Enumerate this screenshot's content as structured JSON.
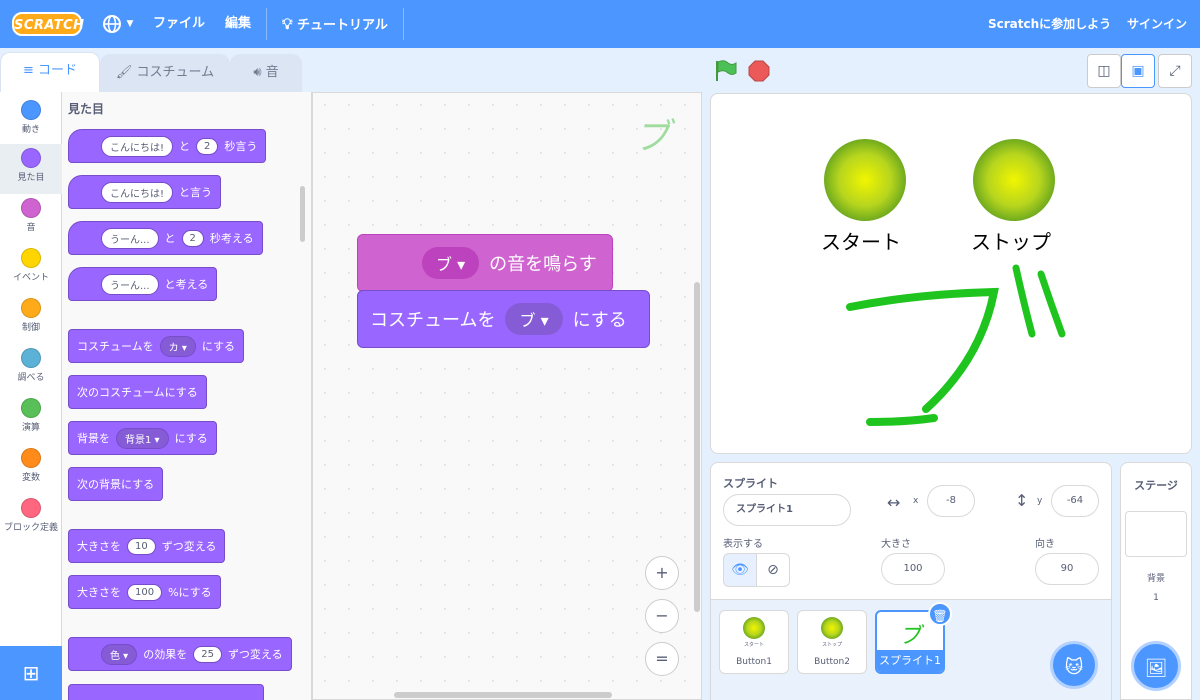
{
  "menubar": {
    "logo": "SCRATCH",
    "file": "ファイル",
    "edit": "編集",
    "tutorials": "チュートリアル",
    "join": "Scratchに参加しよう",
    "signin": "サインイン",
    "color": "#4c97ff"
  },
  "tabs": {
    "code": "コード",
    "costumes": "コスチューム",
    "sounds": "音"
  },
  "categories": [
    {
      "label": "動き",
      "color": "#4c97ff"
    },
    {
      "label": "見た目",
      "color": "#9966ff"
    },
    {
      "label": "音",
      "color": "#cf63cf"
    },
    {
      "label": "イベント",
      "color": "#ffd500"
    },
    {
      "label": "制御",
      "color": "#ffab19"
    },
    {
      "label": "調べる",
      "color": "#5cb1d6"
    },
    {
      "label": "演算",
      "color": "#59c059"
    },
    {
      "label": "変数",
      "color": "#ff8c1a"
    },
    {
      "label": "ブロック定義",
      "color": "#ff6680"
    }
  ],
  "palette": {
    "title": "見た目",
    "blocks": [
      {
        "pre": "",
        "a": "こんにちは!",
        "mid": "と",
        "b": "2",
        "post": "秒言う"
      },
      {
        "pre": "",
        "a": "こんにちは!",
        "post": "と言う"
      },
      {
        "pre": "",
        "a": "うーん...",
        "mid": "と",
        "b": "2",
        "post": "秒考える"
      },
      {
        "pre": "",
        "a": "うーん...",
        "post": "と考える"
      },
      {
        "pre": "コスチュームを",
        "drop": "カ",
        "post": "にする"
      },
      {
        "pre": "次のコスチュームにする"
      },
      {
        "pre": "背景を",
        "drop": "背景1",
        "post": "にする"
      },
      {
        "pre": "次の背景にする"
      },
      {
        "pre": "大きさを",
        "a": "10",
        "post": "ずつ変える"
      },
      {
        "pre": "大きさを",
        "a": "100",
        "post": "%にする"
      },
      {
        "drop": "色",
        "mid": "の効果を",
        "a": "25",
        "post": "ずつ変える"
      }
    ]
  },
  "script": {
    "sound_pre": "",
    "sound_drop": "ブ",
    "sound_post": "の音を鳴らす",
    "looks_pre": "コスチュームを",
    "looks_drop": "ブ",
    "looks_post": "にする",
    "watermark": "ブ"
  },
  "zoom": {
    "in": "+",
    "out": "−",
    "reset": "="
  },
  "stage": {
    "start_label": "スタート",
    "stop_label": "ストップ"
  },
  "sprite_info": {
    "sprite_label": "スプライト",
    "sprite_name": "スプライト1",
    "x_label": "x",
    "x_value": "-8",
    "y_label": "y",
    "y_value": "-64",
    "show_label": "表示する",
    "size_label": "大きさ",
    "size_value": "100",
    "direction_label": "向き",
    "direction_value": "90"
  },
  "sprites": [
    {
      "name": "Button1",
      "mini_label": "スタート"
    },
    {
      "name": "Button2",
      "mini_label": "ストップ"
    },
    {
      "name": "スプライト1",
      "mini_label": "ブ"
    }
  ],
  "stage_pane": {
    "title": "ステージ",
    "backdrops_label": "背景",
    "backdrops_count": "1"
  }
}
